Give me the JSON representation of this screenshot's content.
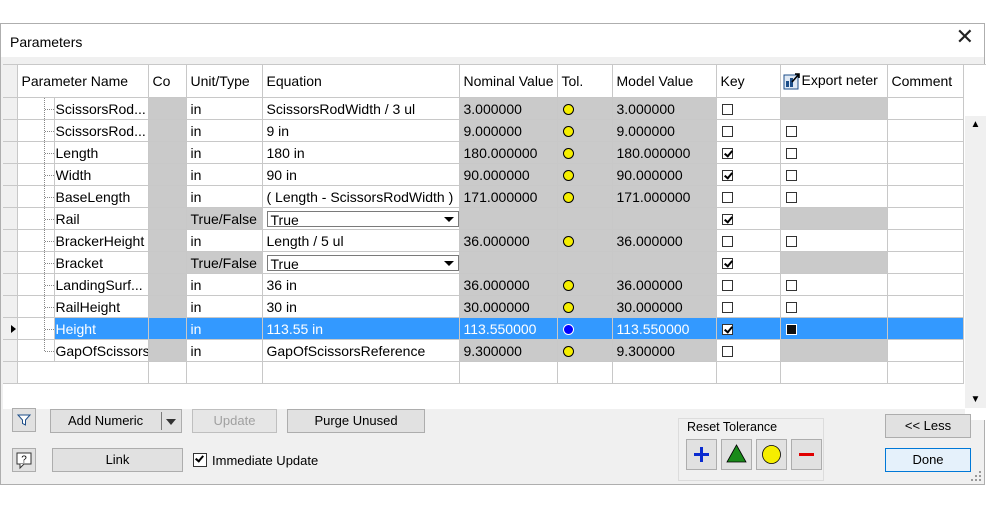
{
  "window": {
    "title": "Parameters"
  },
  "columns": [
    "Parameter Name",
    "Co",
    "Unit/Type",
    "Equation",
    "Nominal Value",
    "Tol.",
    "Model Value",
    "Key",
    "Export neter",
    "Comment"
  ],
  "rows": [
    {
      "name": "ScissorsRod...",
      "unit": "in",
      "equation": "ScissorsRodWidth / 3 ul",
      "nominal": "3.000000",
      "tol": "yellow",
      "model": "3.000000",
      "key": false,
      "export": null,
      "equation_dropdown": false
    },
    {
      "name": "ScissorsRod...",
      "unit": "in",
      "equation": "9 in",
      "nominal": "9.000000",
      "tol": "yellow",
      "model": "9.000000",
      "key": false,
      "export": false,
      "equation_dropdown": false
    },
    {
      "name": "Length",
      "unit": "in",
      "equation": "180 in",
      "nominal": "180.000000",
      "tol": "yellow",
      "model": "180.000000",
      "key": true,
      "export": false,
      "equation_dropdown": false
    },
    {
      "name": "Width",
      "unit": "in",
      "equation": "90 in",
      "nominal": "90.000000",
      "tol": "yellow",
      "model": "90.000000",
      "key": true,
      "export": false,
      "equation_dropdown": false
    },
    {
      "name": "BaseLength",
      "unit": "in",
      "equation": "( Length - ScissorsRodWidth )",
      "nominal": "171.000000",
      "tol": "yellow",
      "model": "171.000000",
      "key": false,
      "export": false,
      "equation_dropdown": false
    },
    {
      "name": "Rail",
      "unit": "True/False",
      "equation": "True",
      "nominal": "",
      "tol": "",
      "model": "",
      "key": true,
      "export": null,
      "equation_dropdown": true
    },
    {
      "name": "BrackerHeight",
      "unit": "in",
      "equation": "Length / 5 ul",
      "nominal": "36.000000",
      "tol": "yellow",
      "model": "36.000000",
      "key": false,
      "export": false,
      "equation_dropdown": false
    },
    {
      "name": "Bracket",
      "unit": "True/False",
      "equation": "True",
      "nominal": "",
      "tol": "",
      "model": "",
      "key": true,
      "export": null,
      "equation_dropdown": true
    },
    {
      "name": "LandingSurf...",
      "unit": "in",
      "equation": "36 in",
      "nominal": "36.000000",
      "tol": "yellow",
      "model": "36.000000",
      "key": false,
      "export": false,
      "equation_dropdown": false
    },
    {
      "name": "RailHeight",
      "unit": "in",
      "equation": "30 in",
      "nominal": "30.000000",
      "tol": "yellow",
      "model": "30.000000",
      "key": false,
      "export": false,
      "equation_dropdown": false
    },
    {
      "name": "Height",
      "unit": "in",
      "equation": "113.55 in",
      "nominal": "113.550000",
      "tol": "blue",
      "model": "113.550000",
      "key": true,
      "export": true,
      "selected": true,
      "equation_dropdown": false
    },
    {
      "name": "GapOfScissors",
      "unit": "in",
      "equation": "GapOfScissorsReference",
      "nominal": "9.300000",
      "tol": "yellow",
      "model": "9.300000",
      "key": false,
      "export": null,
      "equation_dropdown": false
    }
  ],
  "buttons": {
    "add_numeric": "Add Numeric",
    "update": "Update",
    "purge_unused": "Purge Unused",
    "link": "Link",
    "immediate_update": "Immediate Update",
    "less": "<< Less",
    "done": "Done"
  },
  "immediate_update_checked": true,
  "reset_tolerance": {
    "label": "Reset Tolerance"
  },
  "colors": {
    "selection": "#3399ff",
    "grid_gray": "#cacaca",
    "tol_yellow": "#f5ee00",
    "tol_blue": "#0000ff"
  }
}
